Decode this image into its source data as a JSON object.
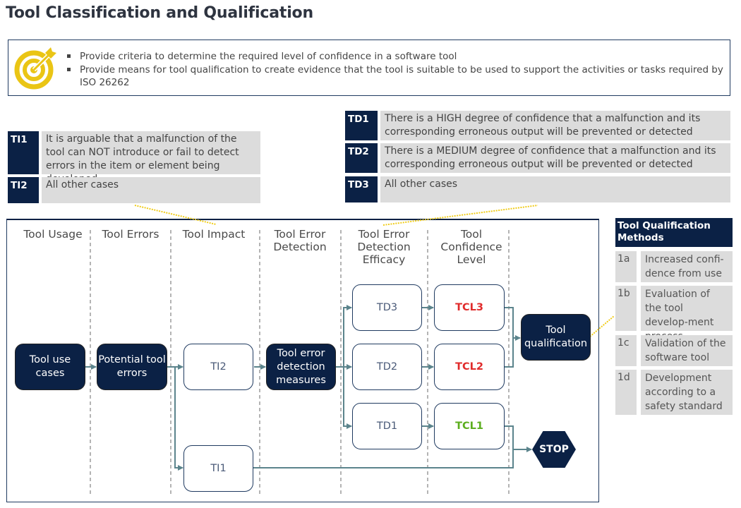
{
  "page": {
    "title": "Tool Classification and Qualification"
  },
  "goals": {
    "icon": "target-icon",
    "items": [
      "Provide criteria to determine the required level of confidence in a software tool",
      "Provide means for tool qualification to create evidence that the tool is suitable to be used to support the activities or tasks required by ISO 26262"
    ]
  },
  "tool_impact": [
    {
      "key": "TI1",
      "text": "It is arguable that a malfunction of the tool can NOT introduce or fail to detect errors in the item or element being developed"
    },
    {
      "key": "TI2",
      "text": "All other cases"
    }
  ],
  "tool_detection": [
    {
      "key": "TD1",
      "text": "There is a HIGH degree of confidence that a malfunction and its corresponding erroneous output will be prevented or detected"
    },
    {
      "key": "TD2",
      "text": "There is a MEDIUM degree of confidence that a malfunction and its corresponding erroneous output will be prevented or detected"
    },
    {
      "key": "TD3",
      "text": "All other cases"
    }
  ],
  "diagram": {
    "columns": [
      "Tool Usage",
      "Tool Errors",
      "Tool Impact",
      "Tool Error Detection",
      "Tool Error Detection Efficacy",
      "Tool Confidence Level"
    ],
    "nodes": {
      "use_cases": "Tool use cases",
      "potential_errors": "Potential tool errors",
      "ti2": "TI2",
      "ti1": "TI1",
      "detection_measures": "Tool error detection measures",
      "td3": "TD3",
      "td2": "TD2",
      "td1": "TD1",
      "tcl3": "TCL3",
      "tcl2": "TCL2",
      "tcl1": "TCL1",
      "qualification": "Tool qualification",
      "stop": "STOP"
    },
    "colors": {
      "tcl3": "#e02b2b",
      "tcl2": "#e02b2b",
      "tcl1": "#5cae1e",
      "arrow": "#5b848c",
      "dark_node": "#0b2145",
      "connector": "#f0cc1a"
    }
  },
  "qualification_methods": {
    "title": "Tool Qualification Methods",
    "items": [
      {
        "key": "1a",
        "text": "Increased confi-dence from use"
      },
      {
        "key": "1b",
        "text": "Evaluation of the tool develop-ment process"
      },
      {
        "key": "1c",
        "text": "Validation of the software tool"
      },
      {
        "key": "1d",
        "text": "Development according to a safety standard"
      }
    ]
  }
}
